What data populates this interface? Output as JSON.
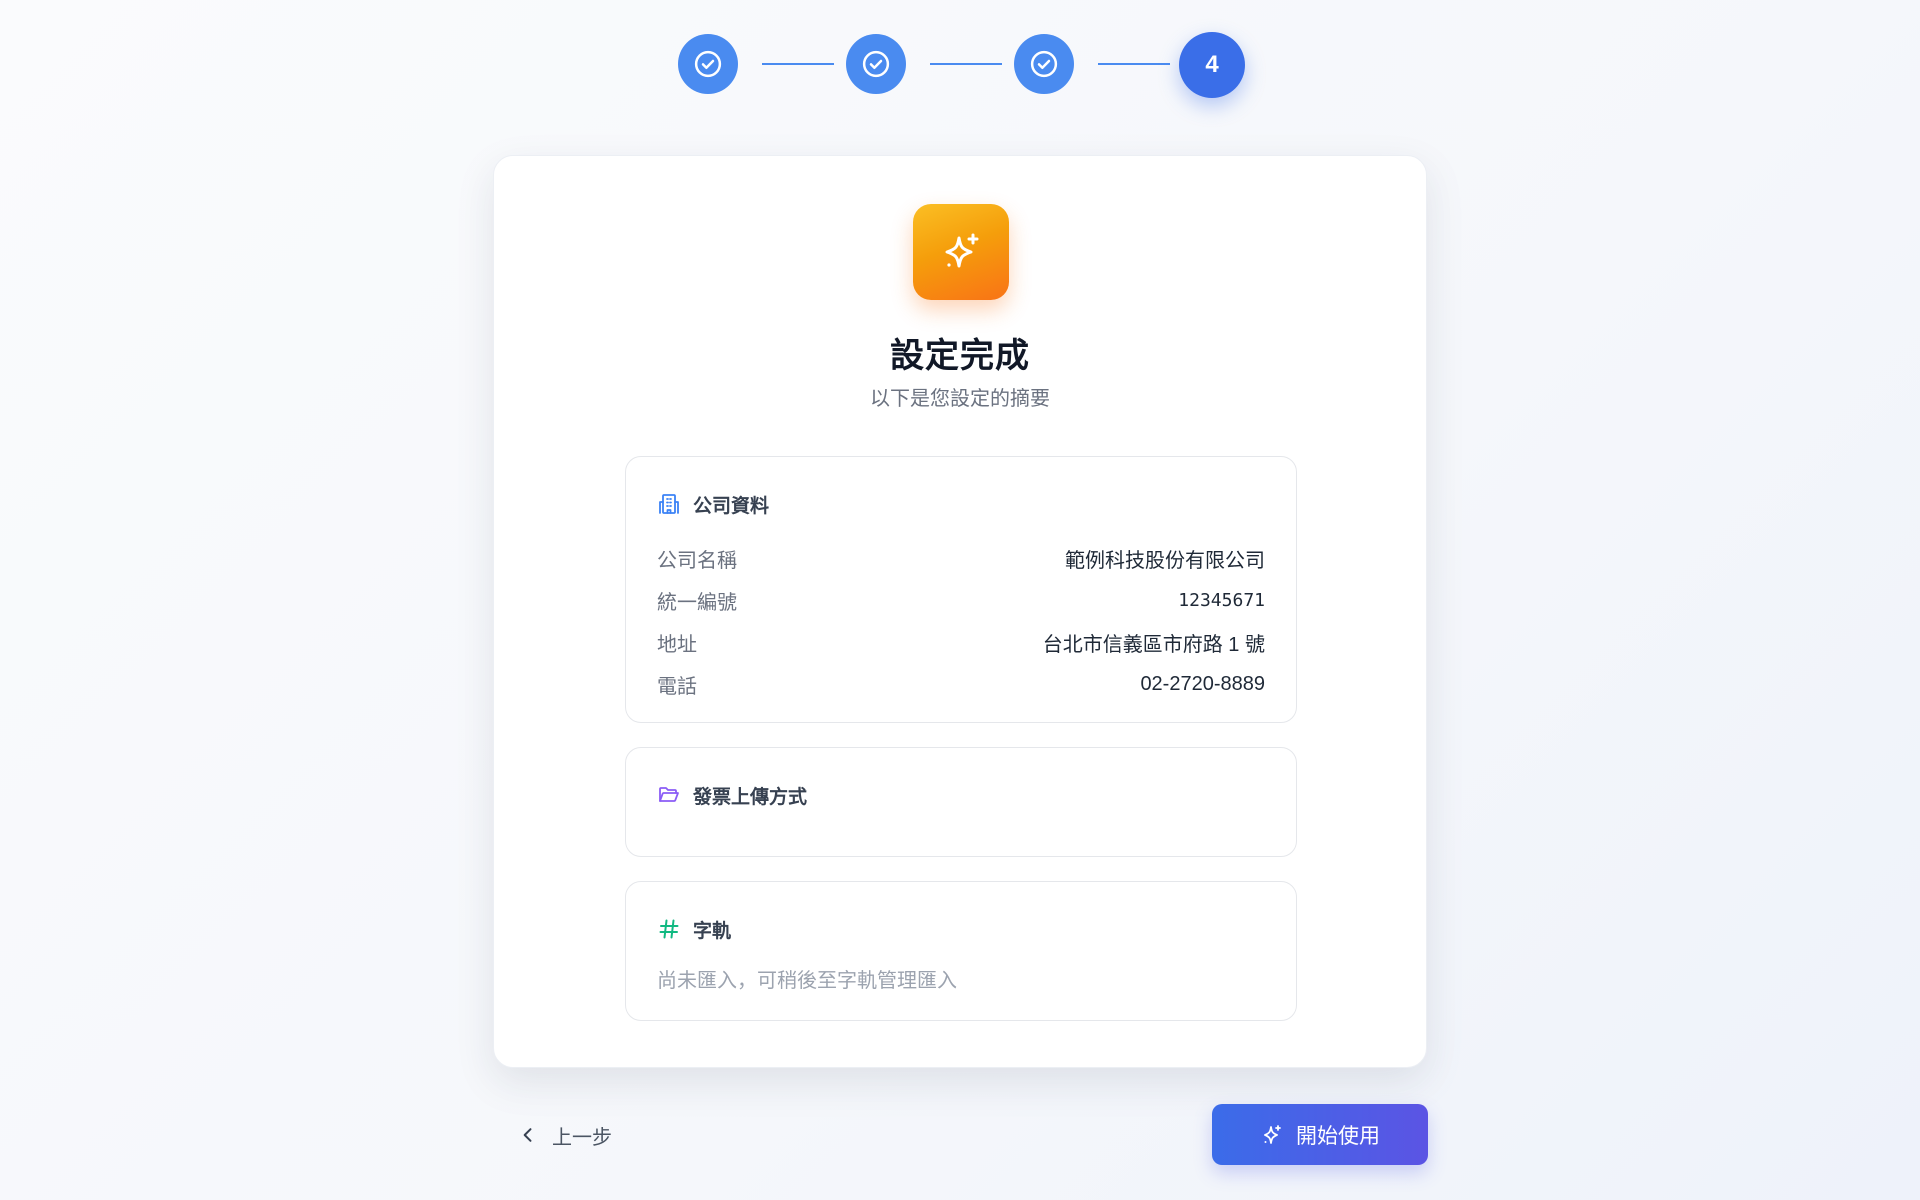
{
  "stepper": {
    "steps": [
      {
        "state": "done",
        "icon": "check-circle-icon"
      },
      {
        "state": "done",
        "icon": "check-circle-icon"
      },
      {
        "state": "done",
        "icon": "check-circle-icon"
      },
      {
        "state": "current",
        "number": "4"
      }
    ],
    "active_color": "#3a6ee8",
    "done_color": "#4a8bf0"
  },
  "summary": {
    "icon": "sparkles-icon",
    "title": "設定完成",
    "subtitle": "以下是您設定的摘要"
  },
  "company": {
    "icon": "building-icon",
    "title": "公司資料",
    "rows": [
      {
        "label": "公司名稱",
        "value": "範例科技股份有限公司"
      },
      {
        "label": "統一編號",
        "value": "12345671"
      },
      {
        "label": "地址",
        "value": "台北市信義區市府路 1 號"
      },
      {
        "label": "電話",
        "value": "02-2720-8889"
      }
    ]
  },
  "upload": {
    "icon": "folder-open-icon",
    "title": "發票上傳方式"
  },
  "track": {
    "icon": "hash-icon",
    "title": "字軌",
    "hint": "尚未匯入，可稍後至字軌管理匯入"
  },
  "footer": {
    "back_label": "上一步",
    "back_icon": "chevron-left-icon",
    "start_label": "開始使用",
    "start_icon": "sparkles-icon"
  },
  "colors": {
    "primary": "#3b6ce9",
    "accent_orange": "#f97316",
    "building_icon": "#3b82f6",
    "folder_icon": "#8b5cf6",
    "hash_icon": "#10b981"
  }
}
